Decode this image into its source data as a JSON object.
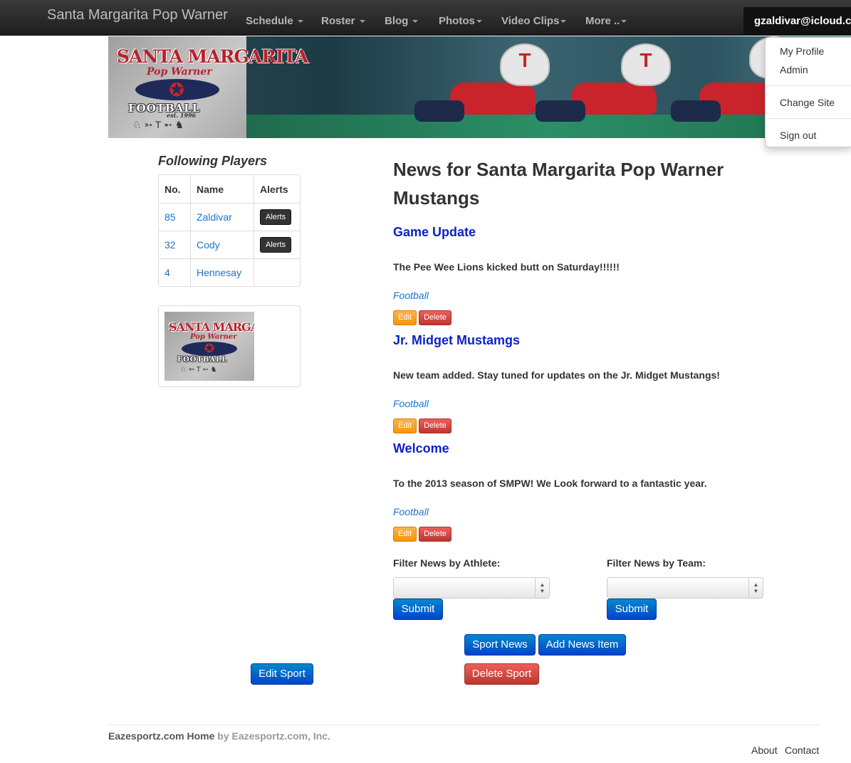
{
  "navbar": {
    "brand": "Santa Margarita Pop Warner",
    "items": [
      {
        "label": "Schedule"
      },
      {
        "label": "Roster"
      },
      {
        "label": "Blog"
      },
      {
        "label": "Photos"
      },
      {
        "label": "Video Clips"
      },
      {
        "label": "More .."
      }
    ],
    "user": "gzaldivar@icloud.com"
  },
  "user_dropdown": {
    "items": [
      {
        "label": "My Profile"
      },
      {
        "label": "Admin"
      },
      {
        "label": "Change Site"
      },
      {
        "label": "Sign out"
      }
    ]
  },
  "banner": {
    "logo_title": "SANTA MARGARITA",
    "logo_sub": "Pop Warner",
    "logo_football": "FOOTBALL",
    "logo_est": "est. 1996"
  },
  "sidebar": {
    "title": "Following Players",
    "columns": [
      "No.",
      "Name",
      "Alerts"
    ],
    "players": [
      {
        "no": "85",
        "name": "Zaldivar",
        "alerts": "Alerts"
      },
      {
        "no": "32",
        "name": "Cody",
        "alerts": "Alerts"
      },
      {
        "no": "4",
        "name": "Hennesay",
        "alerts": ""
      }
    ]
  },
  "news": {
    "title": "News for Santa Margarita Pop Warner Mustangs",
    "items": [
      {
        "headline": "Game Update",
        "body": "The Pee Wee Lions kicked butt on Saturday!!!!!!",
        "tag": "Football",
        "edit": "Edit",
        "delete": "Delete"
      },
      {
        "headline": "Jr. Midget Mustamgs",
        "body": "New team added. Stay tuned for updates on the Jr. Midget Mustangs!",
        "tag": "Football",
        "edit": "Edit",
        "delete": "Delete"
      },
      {
        "headline": "Welcome",
        "body": "To the 2013 season of SMPW! We Look forward to a fantastic year.",
        "tag": "Football",
        "edit": "Edit",
        "delete": "Delete"
      }
    ]
  },
  "filters": {
    "athlete_label": "Filter News by Athlete:",
    "team_label": "Filter News by Team:",
    "athlete_value": "",
    "team_value": "",
    "submit": "Submit"
  },
  "actions": {
    "sport_news": "Sport News",
    "add_news": "Add News Item",
    "edit_sport": "Edit Sport",
    "delete_sport": "Delete Sport"
  },
  "footer": {
    "home": "Eazesportz.com Home",
    "by": "by Eazesportz.com, Inc.",
    "about": "About",
    "contact": "Contact"
  },
  "colors": {
    "navbar": "#222222",
    "link": "#1f73c8",
    "headline": "#0b21c8",
    "primary": "#0055cc",
    "danger": "#bd362f",
    "warning": "#f89406"
  }
}
